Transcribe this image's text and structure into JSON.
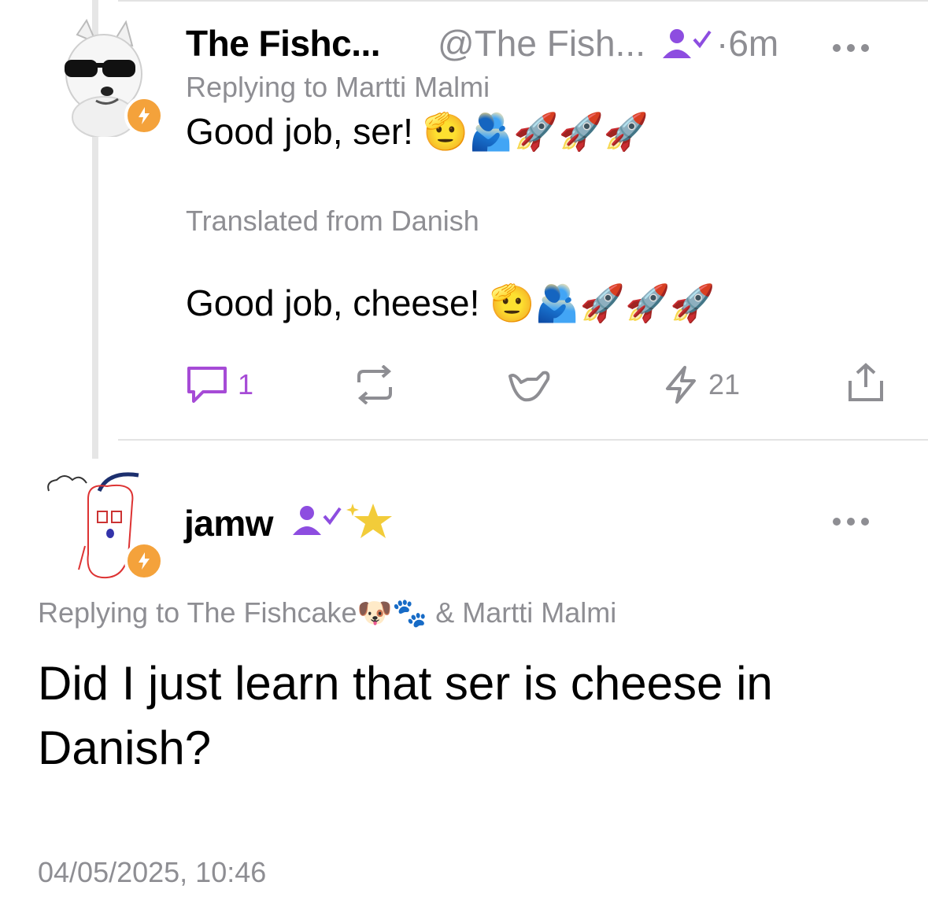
{
  "reply_post": {
    "author_name": "The Fishc...",
    "handle": "@The Fish...",
    "time": "·6m",
    "replying_to": "Replying to Martti Malmi",
    "content": "Good job, ser!",
    "content_emojis": "🫡🫂🚀🚀🚀",
    "translated_label": "Translated from Danish",
    "translated_text": "Good job, cheese!",
    "translated_emojis": "🫡🫂🚀🚀🚀",
    "actions": {
      "comments_count": "1",
      "zaps_count": "21"
    }
  },
  "main_post": {
    "author_name": "jamw",
    "replying_to_prefix": "Replying to The Fishcake",
    "replying_to_emojis": "🐶🐾",
    "replying_to_suffix": " & Martti Malmi",
    "content": "Did I just learn that ser is cheese in Danish?",
    "date": "04/05/2025, 10:46"
  },
  "colors": {
    "accent": "#a64bd6",
    "verified": "#8d4de0",
    "zap": "#f4a23b",
    "muted": "#8e8e93",
    "star": "#f2cc3a"
  }
}
